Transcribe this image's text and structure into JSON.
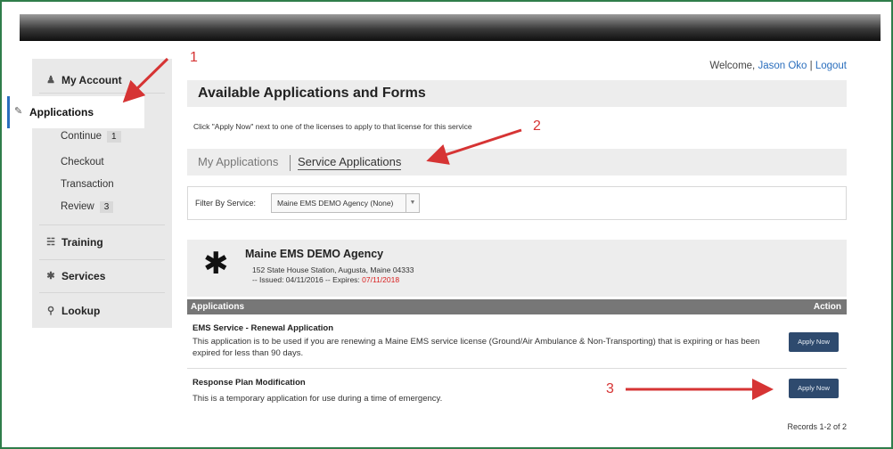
{
  "header": {
    "welcome_prefix": "Welcome, ",
    "user_name": "Jason Oko",
    "separator": " | ",
    "logout": "Logout"
  },
  "sidebar": {
    "my_account": "My Account",
    "applications": "Applications",
    "sub_items": [
      {
        "label": "Continue",
        "badge": "1"
      },
      {
        "label": "Checkout"
      },
      {
        "label": "Transaction"
      },
      {
        "label": "Review",
        "badge": "3"
      }
    ],
    "training": "Training",
    "services": "Services",
    "lookup": "Lookup"
  },
  "main": {
    "title": "Available Applications and Forms",
    "hint": "Click \"Apply Now\" next to one of the licenses to apply to that license for this service",
    "tabs": [
      {
        "label": "My Applications",
        "active": false
      },
      {
        "label": "Service Applications",
        "active": true
      }
    ],
    "filter": {
      "label": "Filter By Service:",
      "selected": "Maine EMS DEMO Agency (None)"
    },
    "agency": {
      "name": "Maine EMS DEMO Agency",
      "address": "152 State House Station, Augusta, Maine 04333",
      "issued_prefix": "-- Issued: 04/11/2016 -- Expires: ",
      "expires": "07/11/2018"
    },
    "table": {
      "col_applications": "Applications",
      "col_action": "Action",
      "rows": [
        {
          "title": "EMS Service - Renewal Application",
          "description": "This application is to be used if you are renewing a Maine EMS service license (Ground/Air Ambulance & Non-Transporting) that is expiring or has been expired for less than 90 days.",
          "button": "Apply Now"
        },
        {
          "title": "Response Plan Modification",
          "description": "This is a temporary application for use during a time of emergency.",
          "button": "Apply Now"
        }
      ]
    },
    "records": "Records 1-2 of 2"
  },
  "annotations": [
    "1",
    "2",
    "3"
  ],
  "colors": {
    "accent": "#2a6ebd",
    "button": "#2e4a6e",
    "annotation": "#d63434",
    "expires": "#d92020",
    "frame": "#2f7d4a"
  }
}
